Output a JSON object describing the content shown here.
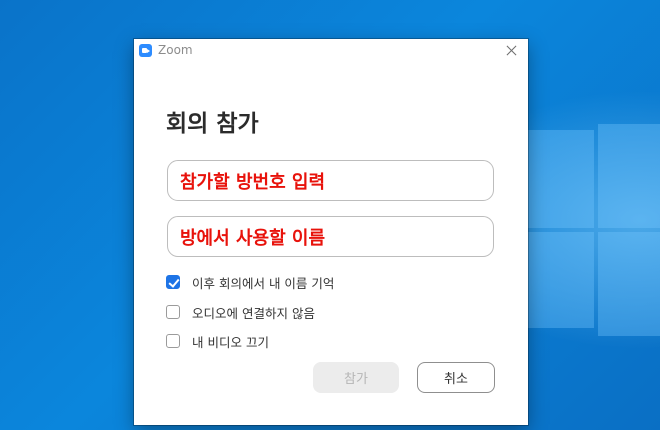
{
  "window": {
    "title": "Zoom",
    "close_icon": "close-icon"
  },
  "dialog": {
    "heading": "회의 참가",
    "meeting_id_field": {
      "value": "참가할 방번호 입력"
    },
    "name_field": {
      "value": "방에서 사용할 이름"
    },
    "options": [
      {
        "label": "이후 회의에서 내 이름 기억",
        "checked": true
      },
      {
        "label": "오디오에 연결하지 않음",
        "checked": false
      },
      {
        "label": "내 비디오 끄기",
        "checked": false
      }
    ],
    "buttons": {
      "join": "참가",
      "cancel": "취소"
    }
  },
  "colors": {
    "accent": "#1e74e6",
    "annotation_text": "#e8120b",
    "desktop": "#0b86dc"
  }
}
